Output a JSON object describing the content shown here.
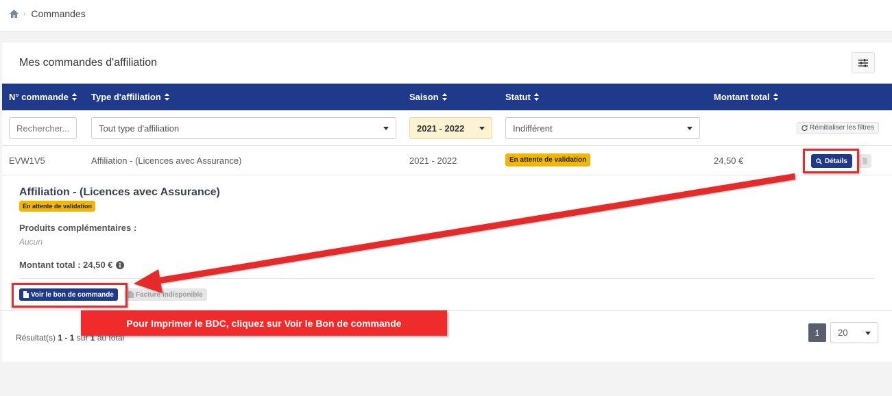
{
  "breadcrumb": {
    "home_icon": "home-icon",
    "current": "Commandes"
  },
  "card": {
    "title": "Mes commandes d'affiliation",
    "filter_icon": "sliders-icon"
  },
  "table": {
    "headers": [
      "N° commande",
      "Type d'affiliation",
      "Saison",
      "Statut",
      "Montant total"
    ],
    "filters": {
      "search_placeholder": "Rechercher...",
      "type_value": "Tout type d'affiliation",
      "season_value": "2021 - 2022",
      "status_value": "Indifférent",
      "reset_label": "Réinitialiser les filtres"
    },
    "rows": [
      {
        "order_number": "EVW1V5",
        "type": "Affiliation - (Licences avec Assurance)",
        "season": "2021 - 2022",
        "status": "En attente de validation",
        "total": "24,50 €",
        "details_label": "Détails"
      }
    ]
  },
  "detail": {
    "title": "Affiliation - (Licences avec Assurance)",
    "status": "En attente de validation",
    "complementary_label": "Produits complémentaires :",
    "complementary_value": "Aucun",
    "total_label": "Montant total : 24,50 €",
    "view_order_label": "Voir le bon de commande",
    "invoice_label": "Facture indisponible"
  },
  "footer": {
    "results_prefix": "Résultat(s)",
    "range_start": "1",
    "range_sep": "-",
    "range_end": "1",
    "of_word": "sur",
    "total": "1",
    "total_suffix": "au total",
    "current_page": "1",
    "per_page": "20"
  },
  "annotation": {
    "callout_text": "Pour Imprimer le BDC, cliquez sur Voir le Bon de commande"
  },
  "colors": {
    "header_blue": "#1f3a8a",
    "status_yellow": "#f2b705",
    "annotation_red": "#ef2b2b"
  }
}
